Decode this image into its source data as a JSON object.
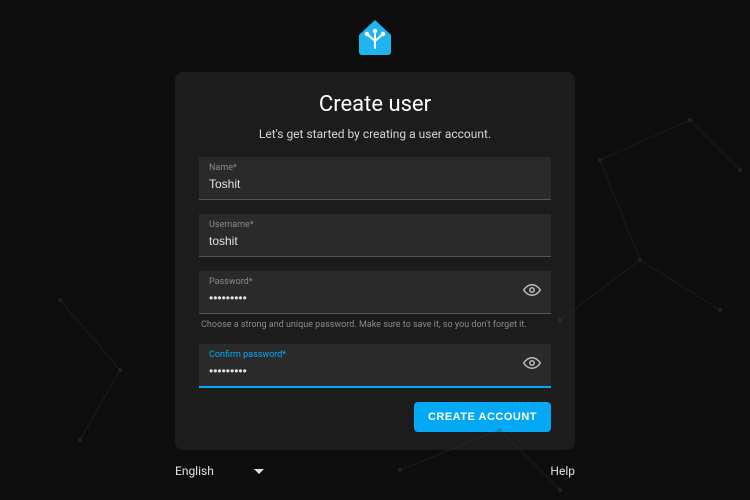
{
  "brand": {
    "accent": "#03a9f4"
  },
  "page": {
    "title": "Create user",
    "subtitle": "Let's get started by creating a user account."
  },
  "fields": {
    "name": {
      "label": "Name*",
      "value": "Toshit"
    },
    "username": {
      "label": "Username*",
      "value": "toshit"
    },
    "password": {
      "label": "Password*",
      "value": "•••••••••",
      "helper": "Choose a strong and unique password. Make sure to save it, so you don't forget it."
    },
    "confirm": {
      "label": "Confirm password*",
      "value": "•••••••••"
    }
  },
  "actions": {
    "submit": "Create Account"
  },
  "footer": {
    "language": "English",
    "help": "Help"
  }
}
